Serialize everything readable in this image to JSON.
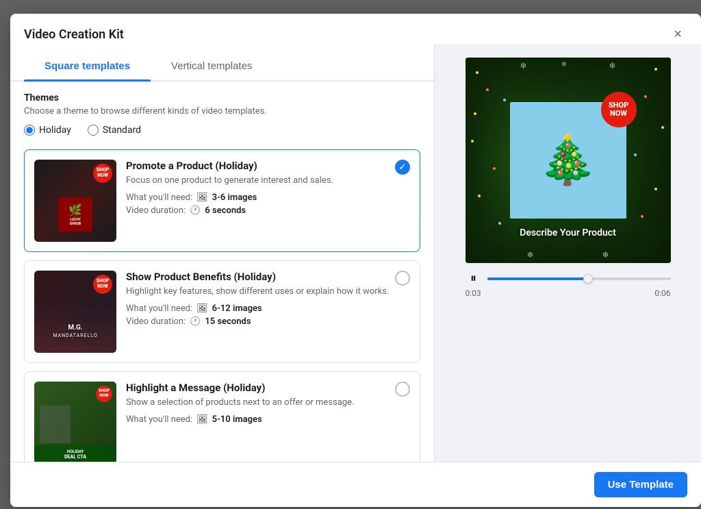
{
  "modal": {
    "title": "Video Creation Kit",
    "close_label": "×"
  },
  "tabs": [
    {
      "id": "square",
      "label": "Square templates",
      "active": true
    },
    {
      "id": "vertical",
      "label": "Vertical templates",
      "active": false
    }
  ],
  "themes": {
    "title": "Themes",
    "description": "Choose a theme to browse different kinds of video templates.",
    "options": [
      {
        "id": "holiday",
        "label": "Holiday",
        "selected": true
      },
      {
        "id": "standard",
        "label": "Standard",
        "selected": false
      }
    ]
  },
  "templates": [
    {
      "id": "promote",
      "name": "Promote a Product (Holiday)",
      "description": "Focus on one product to generate interest and sales.",
      "images_label": "What you'll need:",
      "images_count": "3-6 images",
      "duration_label": "Video duration:",
      "duration_value": "6 seconds",
      "selected": true
    },
    {
      "id": "benefits",
      "name": "Show Product Benefits (Holiday)",
      "description": "Highlight key features, show different uses or explain how it works.",
      "images_label": "What you'll need:",
      "images_count": "6-12 images",
      "duration_label": "Video duration:",
      "duration_value": "15 seconds",
      "selected": false
    },
    {
      "id": "message",
      "name": "Highlight a Message (Holiday)",
      "description": "Show a selection of products next to an offer or message.",
      "images_label": "What you'll need:",
      "images_count": "5-10 images",
      "selected": false
    }
  ],
  "preview": {
    "shop_badge": "SHOP\nNOW",
    "describe_text": "Describe Your Product",
    "time_current": "0:03",
    "time_total": "0:06",
    "progress_percent": 55
  },
  "footer": {
    "use_template_label": "Use Template"
  }
}
